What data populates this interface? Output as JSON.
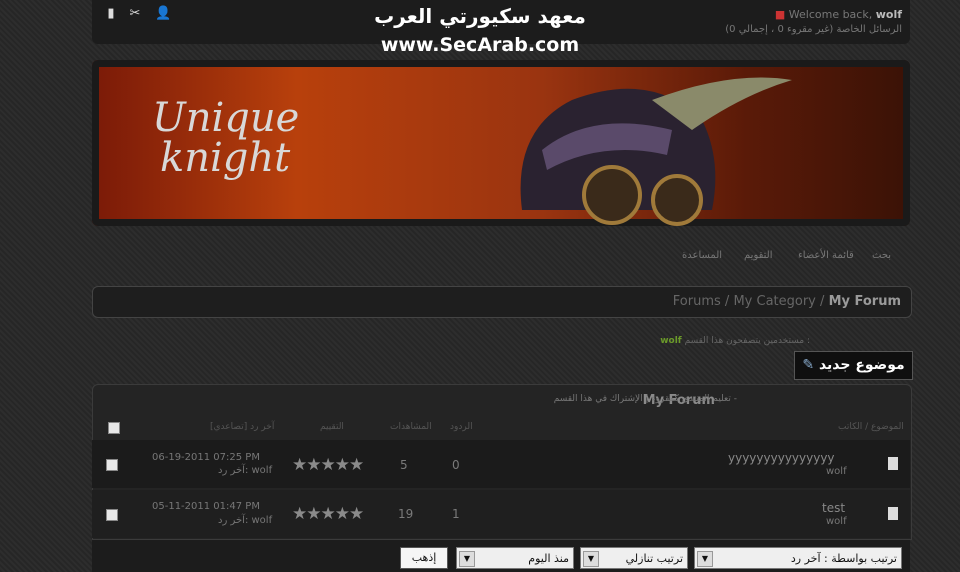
{
  "watermark": {
    "line1": "معهد سكيورتي العرب",
    "line2": "www.SecArab.com"
  },
  "topbar": {
    "welcome": "Welcome back,",
    "user": "wolf",
    "pm": "الرسائل الخاصة (غير مقروء 0 ، إجمالي 0)",
    "icons": [
      "user-icon",
      "tools-icon",
      "mobile-icon"
    ]
  },
  "banner": {
    "line1": "Unique",
    "line2": "knight"
  },
  "nav": {
    "items": [
      "بحث",
      "قائمة الأعضاء",
      "التقويم",
      "المساعدة"
    ]
  },
  "breadcrumb": {
    "forums": "Forums",
    "sep": "/",
    "category": "My Category",
    "current": "My Forum"
  },
  "viewers": {
    "label": "مستخدمين يتصفحون هذا القسم :",
    "user": "wolf"
  },
  "new_topic": "موضوع جديد",
  "table": {
    "title": "My Forum",
    "links": "تعليم المنتدى كمقروء | الإشتراك في هذا القسم -",
    "headers": {
      "topic": "الموضوع / الكاتب",
      "replies": "الردود",
      "views": "المشاهدات",
      "rating": "التقييم",
      "lastpost": "آخر رد [تصاعدي]"
    },
    "rows": [
      {
        "title": "yyyyyyyyyyyyyyy",
        "author": "wolf",
        "replies": "0",
        "views": "5",
        "date": "06-19-2011 07:25 PM",
        "lastby": "آخر رد: wolf"
      },
      {
        "title": "test",
        "author": "wolf",
        "replies": "1",
        "views": "19",
        "date": "05-11-2011 01:47 PM",
        "lastby": "آخر رد: wolf"
      }
    ]
  },
  "sort": {
    "by": "ترتيب بواسطة : آخر رد",
    "order": "ترتيب تنازلي",
    "since": "منذ اليوم",
    "go": "إذهب"
  }
}
